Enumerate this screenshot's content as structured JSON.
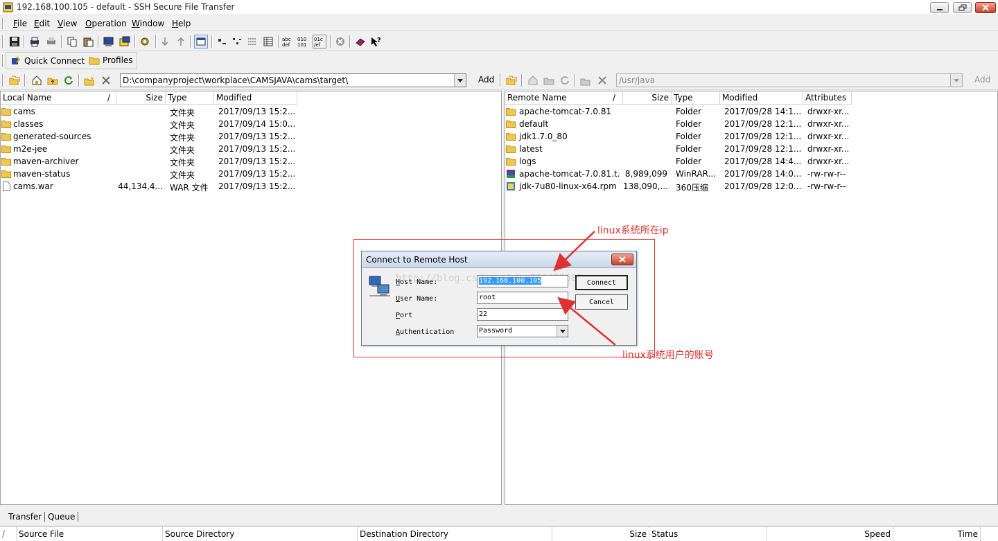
{
  "window": {
    "title": "192.168.100.105 - default - SSH Secure File Transfer"
  },
  "menu": [
    {
      "label": "File",
      "key": "F",
      "rest": "ile"
    },
    {
      "label": "Edit",
      "key": "E",
      "rest": "dit"
    },
    {
      "label": "View",
      "key": "V",
      "rest": "iew"
    },
    {
      "label": "Operation",
      "key": "O",
      "rest": "peration"
    },
    {
      "label": "Window",
      "key": "W",
      "rest": "indow"
    },
    {
      "label": "Help",
      "key": "H",
      "rest": "elp"
    }
  ],
  "quick": {
    "connect_label": "Quick Connect",
    "profiles_label": "Profiles"
  },
  "local": {
    "path": "D:\\companyproject\\workplace\\CAMSJAVA\\cams\\target\\",
    "add_label": "Add",
    "columns": [
      "Local Name",
      "/",
      "Size",
      "Type",
      "Modified"
    ],
    "rows": [
      {
        "name": "cams",
        "size": "",
        "type": "文件夹",
        "modified": "2017/09/13 15:2...",
        "icon": "folder-icon"
      },
      {
        "name": "classes",
        "size": "",
        "type": "文件夹",
        "modified": "2017/09/14 15:0...",
        "icon": "folder-icon"
      },
      {
        "name": "generated-sources",
        "size": "",
        "type": "文件夹",
        "modified": "2017/09/13 15:2...",
        "icon": "folder-icon"
      },
      {
        "name": "m2e-jee",
        "size": "",
        "type": "文件夹",
        "modified": "2017/09/13 15:2...",
        "icon": "folder-icon"
      },
      {
        "name": "maven-archiver",
        "size": "",
        "type": "文件夹",
        "modified": "2017/09/13 15:2...",
        "icon": "folder-icon"
      },
      {
        "name": "maven-status",
        "size": "",
        "type": "文件夹",
        "modified": "2017/09/13 15:2...",
        "icon": "folder-icon"
      },
      {
        "name": "cams.war",
        "size": "44,134,4...",
        "type": "WAR 文件",
        "modified": "2017/09/13 15:2...",
        "icon": "file-icon"
      }
    ]
  },
  "remote": {
    "path": "/usr/java",
    "add_label": "Add",
    "columns": [
      "Remote Name",
      "/",
      "Size",
      "Type",
      "Modified",
      "Attributes"
    ],
    "rows": [
      {
        "name": "apache-tomcat-7.0.81",
        "size": "",
        "type": "Folder",
        "modified": "2017/09/28 14:1...",
        "attr": "drwxr-xr...",
        "icon": "folder-icon"
      },
      {
        "name": "default",
        "size": "",
        "type": "Folder",
        "modified": "2017/09/28 12:1...",
        "attr": "drwxr-xr...",
        "icon": "folder-icon"
      },
      {
        "name": "jdk1.7.0_80",
        "size": "",
        "type": "Folder",
        "modified": "2017/09/28 12:1...",
        "attr": "drwxr-xr...",
        "icon": "folder-icon"
      },
      {
        "name": "latest",
        "size": "",
        "type": "Folder",
        "modified": "2017/09/28 12:1...",
        "attr": "drwxr-xr...",
        "icon": "folder-icon"
      },
      {
        "name": "logs",
        "size": "",
        "type": "Folder",
        "modified": "2017/09/28 14:4...",
        "attr": "drwxr-xr...",
        "icon": "folder-icon"
      },
      {
        "name": "apache-tomcat-7.0.81.t...",
        "size": "8,989,099",
        "type": "WinRAR...",
        "modified": "2017/09/28 14:0...",
        "attr": "-rw-rw-r--",
        "icon": "archive-icon"
      },
      {
        "name": "jdk-7u80-linux-x64.rpm",
        "size": "138,090,...",
        "type": "360压缩",
        "modified": "2017/09/28 12:0...",
        "attr": "-rw-rw-r--",
        "icon": "rpm-archive-icon"
      }
    ]
  },
  "dialog": {
    "title": "Connect to Remote Host",
    "host_label_key": "H",
    "host_label_rest": "ost Name:",
    "host_value": "192.168.100.105",
    "user_label_key": "U",
    "user_label_rest": "ser Name:",
    "user_value": "root",
    "port_label_key": "P",
    "port_label_rest": "ort",
    "port_value": "22",
    "auth_label_key": "A",
    "auth_label_rest": "uthentication",
    "auth_value": "Password",
    "connect_label": "Connect",
    "cancel_label": "Cancel",
    "watermark": "http://blog.csdn.net/yy339452689"
  },
  "annotations": {
    "ip_note": "linux系统所在ip",
    "user_note": "linux系统用户的账号",
    "color": "#e03030"
  },
  "bottom": {
    "tabs": [
      "Transfer",
      "Queue"
    ],
    "columns": [
      "/",
      "Source File",
      "Source Directory",
      "Destination Directory",
      "Size",
      "Status",
      "Speed",
      "Time"
    ]
  }
}
